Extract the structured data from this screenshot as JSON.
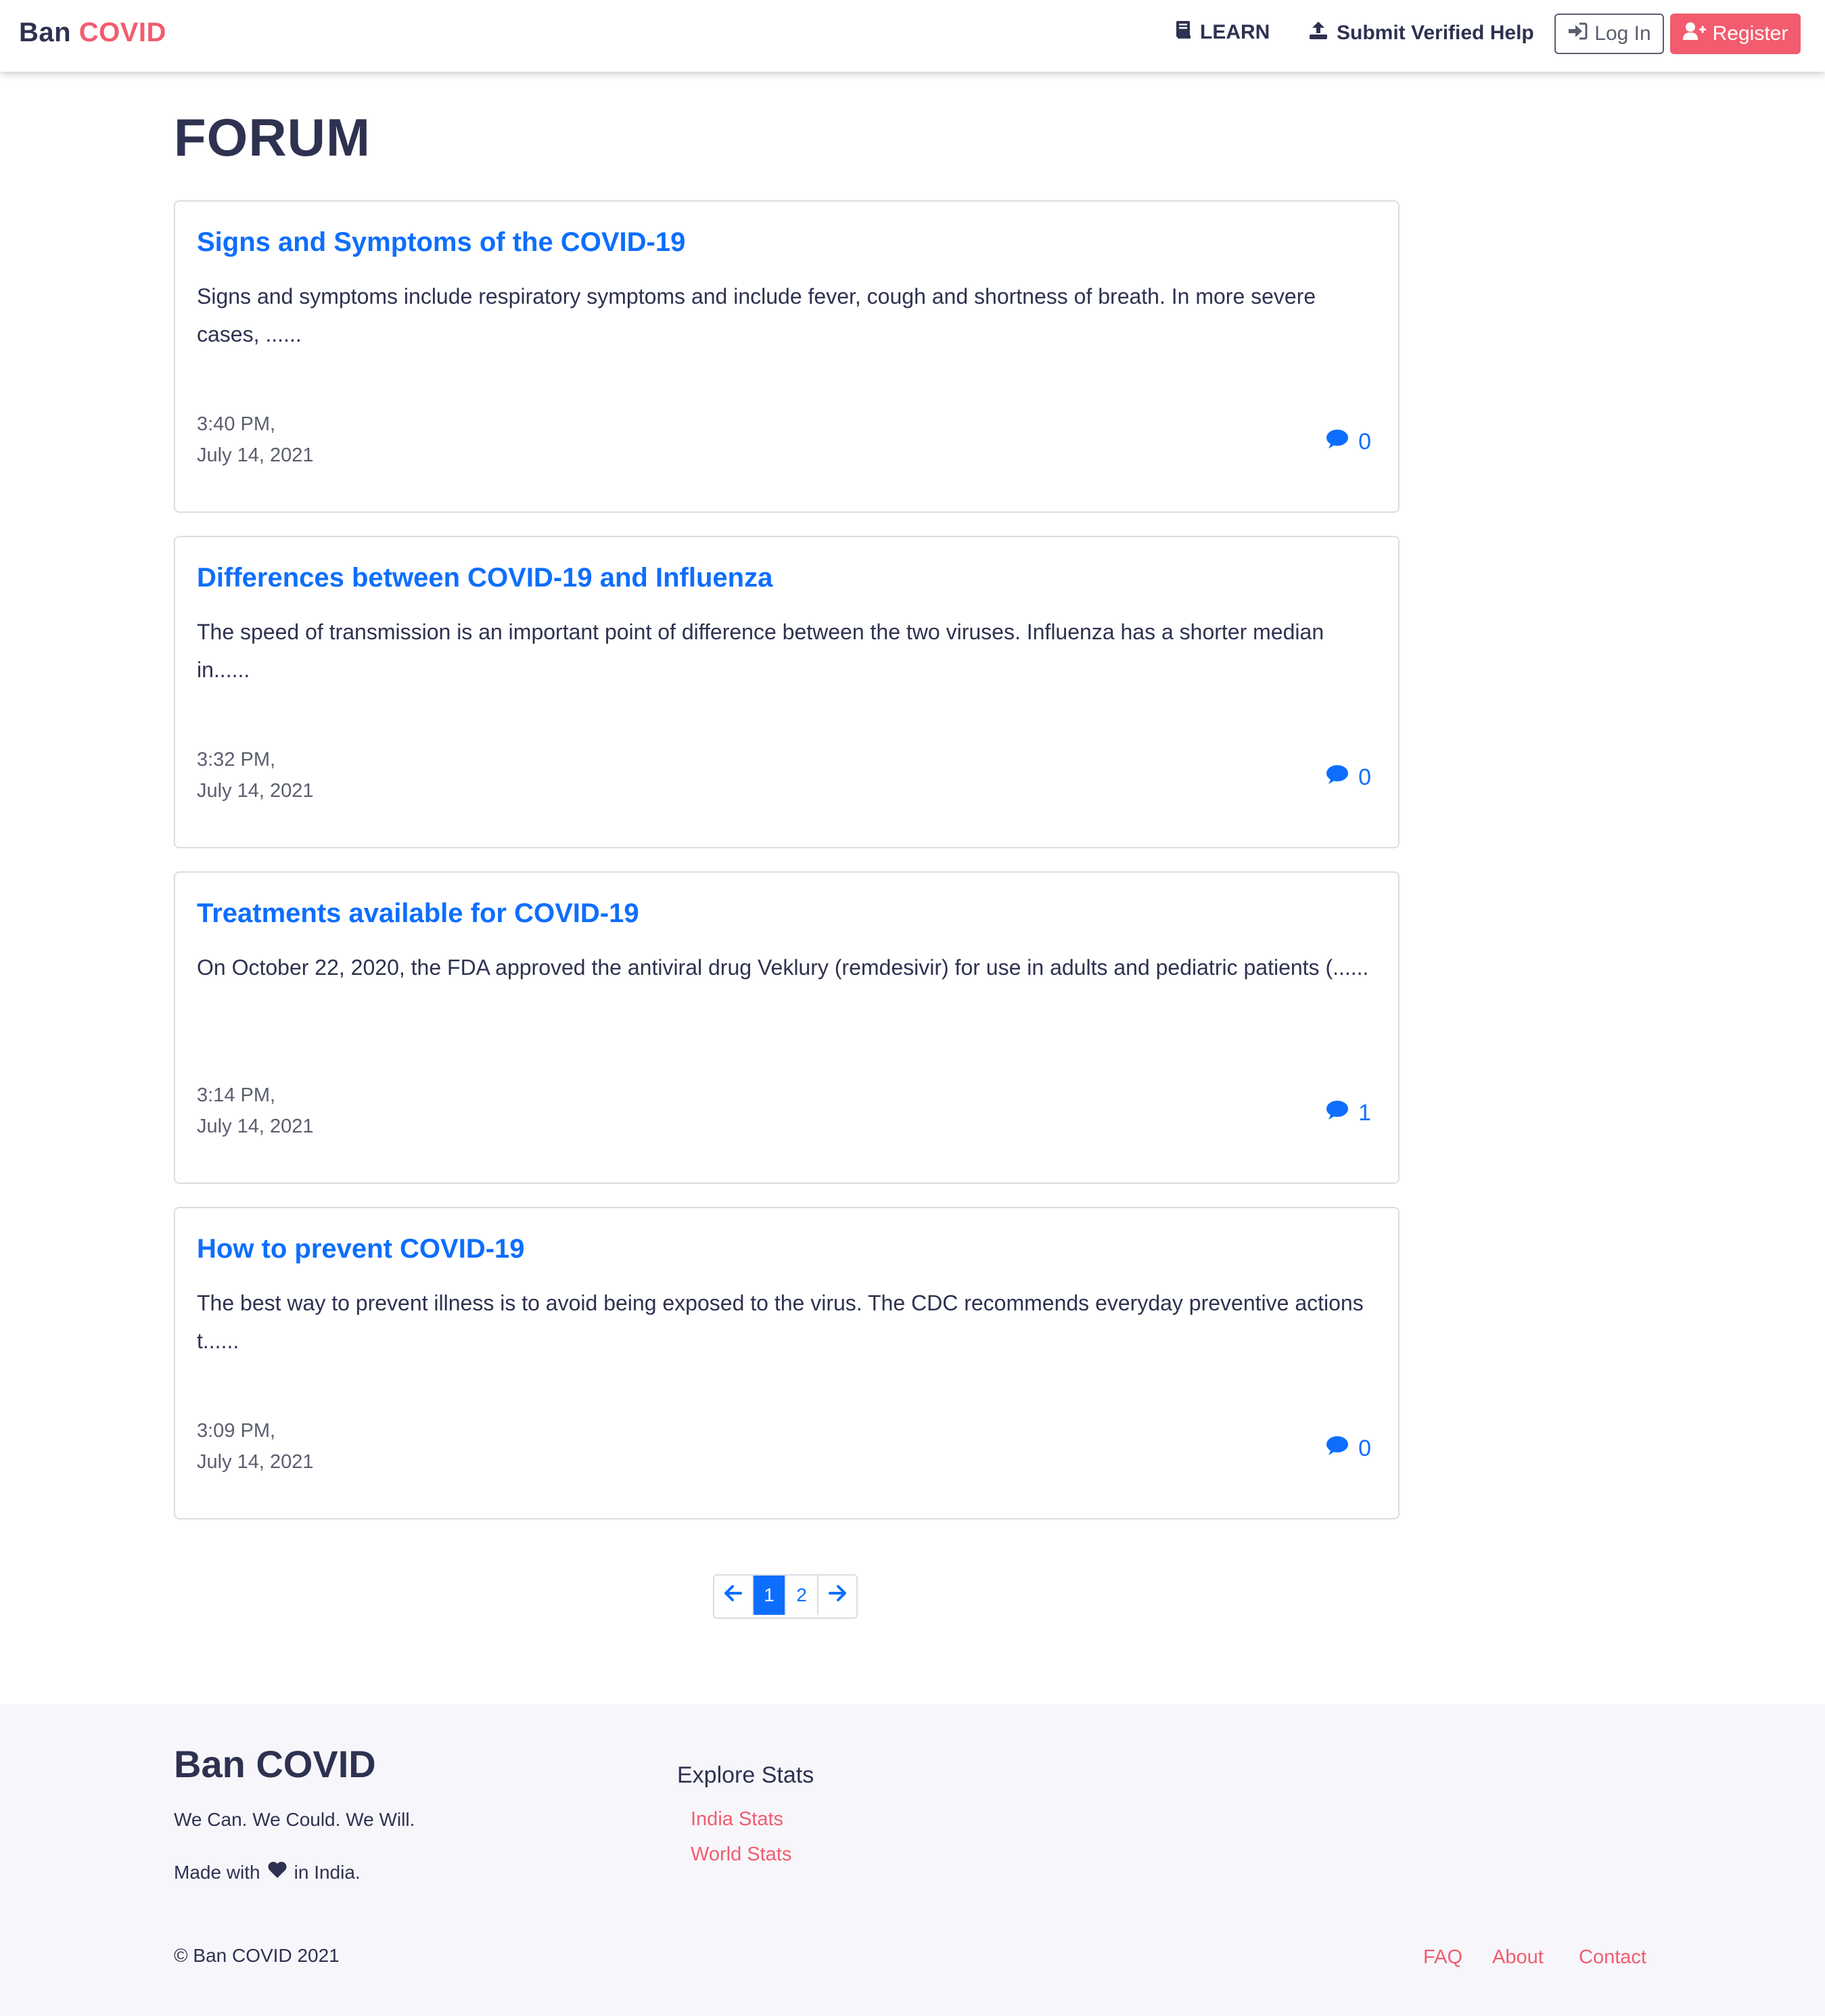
{
  "brand": {
    "name": "Ban",
    "accent": "COVID"
  },
  "nav": {
    "learn": "LEARN",
    "submit": "Submit Verified Help",
    "login": "Log In",
    "register": "Register"
  },
  "page_title": "FORUM",
  "posts": [
    {
      "title": "Signs and Symptoms of the COVID-19",
      "excerpt": "Signs and symptoms include respiratory symptoms and include fever, cough and shortness of breath. In more severe cases, ......",
      "time": "3:40 PM,",
      "date": "July 14, 2021",
      "comments": "0"
    },
    {
      "title": "Differences between COVID-19 and Influenza",
      "excerpt": "The speed of transmission is an important point of difference between the two viruses. Influenza has a shorter median in......",
      "time": "3:32 PM,",
      "date": "July 14, 2021",
      "comments": "0"
    },
    {
      "title": "Treatments available for COVID-19",
      "excerpt": "On October 22, 2020, the FDA approved the antiviral drug Veklury (remdesivir) for use in adults and pediatric patients (......",
      "time": "3:14 PM,",
      "date": "July 14, 2021",
      "comments": "1"
    },
    {
      "title": "How to prevent COVID-19",
      "excerpt": "The best way to prevent illness is to avoid being exposed to the virus. The CDC recommends everyday preventive actions t......",
      "time": "3:09 PM,",
      "date": "July 14, 2021",
      "comments": "0"
    }
  ],
  "pagination": {
    "pages": [
      "1",
      "2"
    ],
    "current": "1"
  },
  "footer": {
    "brand": "Ban COVID",
    "tagline": "We Can. We Could. We Will.",
    "made_prefix": "Made with",
    "made_suffix": "in India.",
    "explore_title": "Explore Stats",
    "india_stats": "India Stats",
    "world_stats": "World Stats",
    "copyright": "© Ban COVID 2021",
    "faq": "FAQ",
    "about": "About",
    "contact": "Contact"
  },
  "colors": {
    "accent": "#f25c6e",
    "link": "#0d6efd",
    "text": "#2e3250"
  }
}
